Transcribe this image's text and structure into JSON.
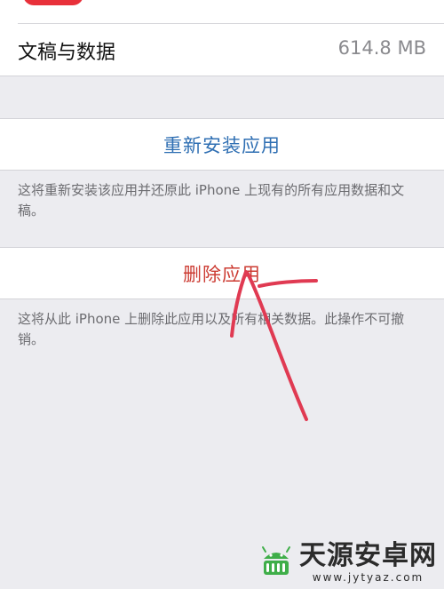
{
  "storage": {
    "docs_label": "文稿与数据",
    "docs_value": "614.8 MB"
  },
  "reinstall": {
    "label": "重新安装应用",
    "note": "这将重新安装该应用并还原此 iPhone 上现有的所有应用数据和文稿。"
  },
  "delete": {
    "label": "删除应用",
    "note": "这将从此 iPhone 上删除此应用以及所有相关数据。此操作不可撤销。"
  },
  "watermark": {
    "title": "天源安卓网",
    "url": "www.jytyaz.com",
    "logo_icon": "android-logo-icon",
    "logo_color": "#3fae49"
  },
  "colors": {
    "background": "#ececf0",
    "link_blue": "#2f6fb3",
    "destructive_red": "#cc3b32",
    "annotation_red": "#e03a52"
  }
}
